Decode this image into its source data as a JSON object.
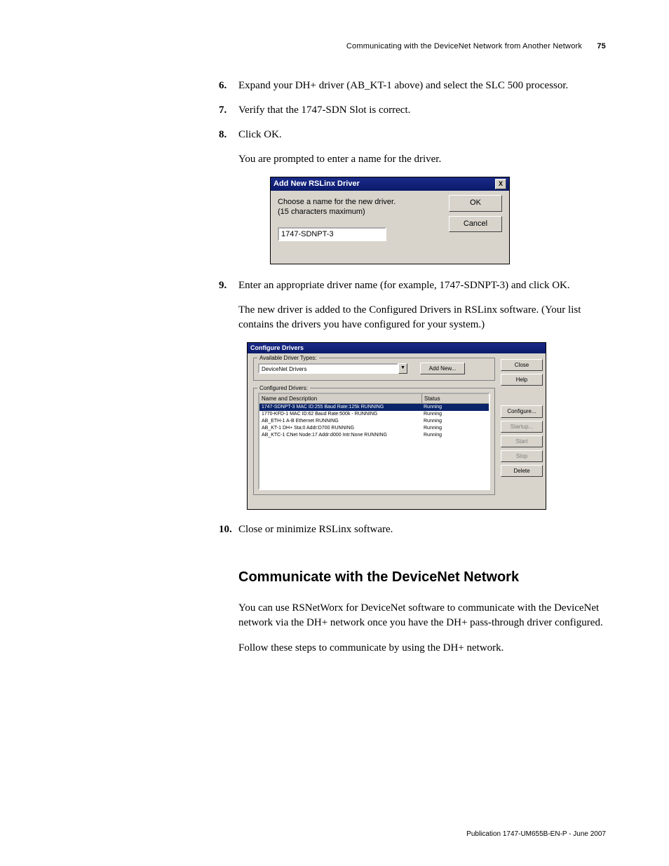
{
  "header": {
    "chapter_title": "Communicating with the DeviceNet Network from Another Network",
    "page_number": "75"
  },
  "steps": {
    "s6_num": "6.",
    "s6_text": "Expand your DH+ driver (AB_KT-1 above) and select the SLC 500 processor.",
    "s7_num": "7.",
    "s7_text": "Verify that the 1747-SDN Slot is correct.",
    "s8_num": "8.",
    "s8_text": "Click OK.",
    "s8_after": "You are prompted to enter a name for the driver.",
    "s9_num": "9.",
    "s9_text": "Enter an appropriate driver name (for example, 1747-SDNPT-3) and click OK.",
    "s9_after": "The new driver is added to the Configured Drivers in RSLinx software. (Your list contains the drivers you have configured for your system.)",
    "s10_num": "10.",
    "s10_text": "Close or minimize RSLinx software."
  },
  "dialog1": {
    "title": "Add New RSLinx Driver",
    "close_x": "X",
    "prompt_line1": "Choose a name for the new driver.",
    "prompt_line2": "(15 characters maximum)",
    "input_value": "1747-SDNPT-3",
    "ok_label": "OK",
    "cancel_label": "Cancel"
  },
  "dialog2": {
    "title": "Configure Drivers",
    "avail_legend": "Available Driver Types:",
    "combo_value": "DeviceNet Drivers",
    "addnew_label": "Add New...",
    "conf_legend": "Configured Drivers:",
    "col_name": "Name and Description",
    "col_status": "Status",
    "rows": [
      {
        "name": "1747-SDNPT-3  MAC ID:255  Baud Rate:125k   RUNNING",
        "status": "Running",
        "selected": true
      },
      {
        "name": "1770-KFD-1  MAC ID:62  Baud Rate:500k - RUNNING",
        "status": "Running",
        "selected": false
      },
      {
        "name": "AB_ETH-1  A-B Ethernet  RUNNING",
        "status": "Running",
        "selected": false
      },
      {
        "name": "AB_KT-1  DH+  Sta:0  Addr:D700  RUNNING",
        "status": "Running",
        "selected": false
      },
      {
        "name": "AB_KTC-1 CNet Node:17 Addr:d000 Intr:None RUNNING",
        "status": "Running",
        "selected": false
      }
    ],
    "side_buttons": {
      "close": "Close",
      "help": "Help",
      "configure": "Configure...",
      "startup": "Startup...",
      "start": "Start",
      "stop": "Stop",
      "delete": "Delete"
    }
  },
  "section2": {
    "heading": "Communicate with the DeviceNet Network",
    "p1": "You can use RSNetWorx for DeviceNet software to communicate with the DeviceNet network via the DH+ network once you have the DH+ pass-through driver configured.",
    "p2": "Follow these steps to communicate by using the DH+ network."
  },
  "footer": {
    "text": "Publication 1747-UM655B-EN-P - June 2007"
  }
}
